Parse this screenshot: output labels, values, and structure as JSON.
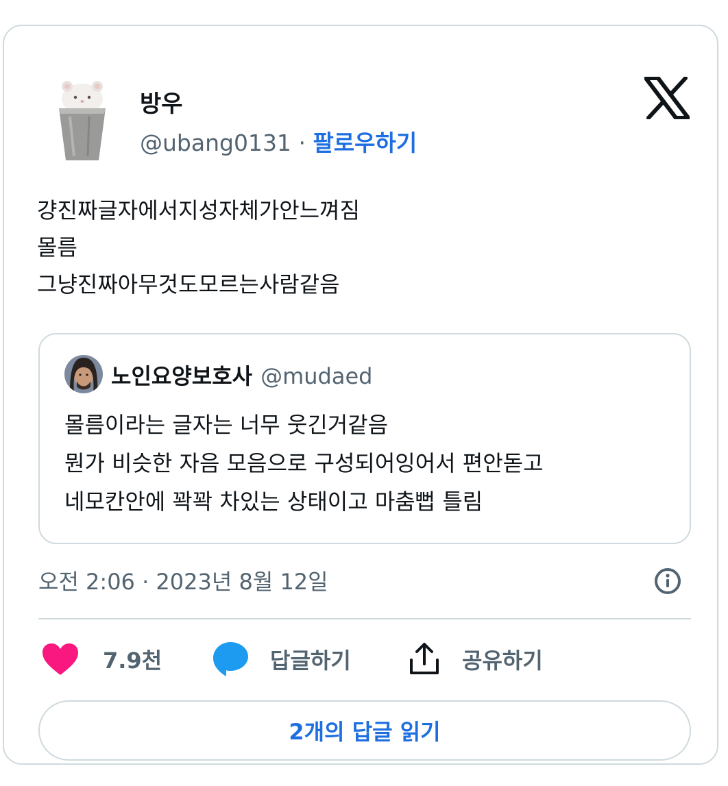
{
  "author": {
    "name": "방우",
    "handle": "@ubang0131",
    "separator": "·",
    "follow_label": "팔로우하기",
    "avatar_icon": "hamster-in-cup-avatar"
  },
  "platform_icon": "x-logo-icon",
  "tweet": {
    "lines": [
      "걍진짜글자에서지성자체가안느껴짐",
      "몰름",
      "그냥진짜아무것도모르는사람같음"
    ]
  },
  "quoted": {
    "name": "노인요양보호사",
    "handle": "@mudaed",
    "lines": [
      "몰름이라는 글자는 너무 웃긴거같음",
      "뭔가 비슷한 자음 모음으로 구성되어잉어서 편안돋고",
      "네모칸안에 꽉꽉 차있는 상태이고 마춤뻡 틀림"
    ]
  },
  "timestamp": "오전 2:06 · 2023년 8월 12일",
  "actions": {
    "like_count": "7.9천",
    "reply_label": "답글하기",
    "share_label": "공유하기"
  },
  "read_replies_label": "2개의 답글 읽기",
  "colors": {
    "accent": "#1d6ee0",
    "like": "#f91880",
    "reply_bubble": "#1d9bf0",
    "muted": "#536471",
    "border": "#cfd9de"
  }
}
